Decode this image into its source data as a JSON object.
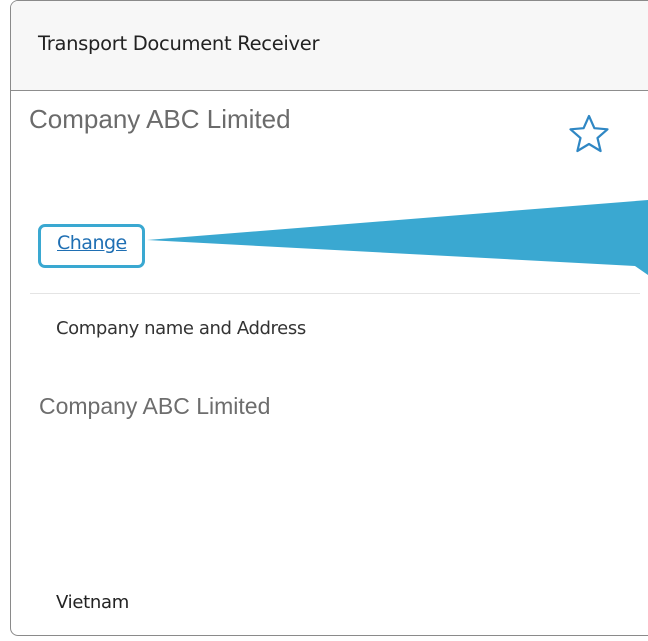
{
  "panel": {
    "title": "Transport Document Receiver",
    "selected_company": "Company ABC Limited",
    "favorite_icon": "star-outline-icon",
    "change_label": "Change",
    "field_label": "Company name and Address",
    "company_name": "Company ABC Limited",
    "country": "Vietnam"
  },
  "colors": {
    "highlight": "#3aa8d1",
    "link": "#1f6fb3",
    "header_bg": "#f7f7f7"
  }
}
